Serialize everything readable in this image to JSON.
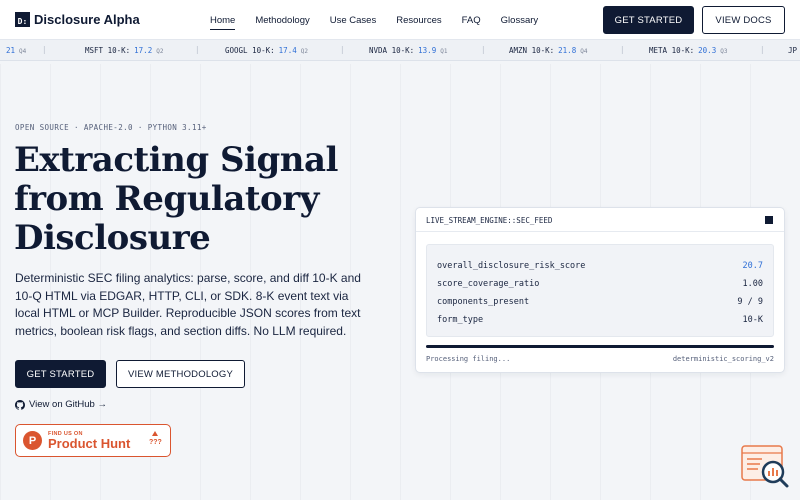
{
  "brand": {
    "mark": "D:",
    "name": "Disclosure Alpha"
  },
  "nav": {
    "items": [
      "Home",
      "Methodology",
      "Use Cases",
      "Resources",
      "FAQ",
      "Glossary"
    ],
    "active": "Home",
    "get_started": "GET STARTED",
    "view_docs": "VIEW DOCS"
  },
  "ticker": [
    {
      "label": "",
      "value": "21",
      "quarter": "Q4"
    },
    {
      "label": "MSFT 10-K:",
      "value": "17.2",
      "quarter": "Q2"
    },
    {
      "label": "GOOGL 10-K:",
      "value": "17.4",
      "quarter": "Q2"
    },
    {
      "label": "NVDA 10-K:",
      "value": "13.9",
      "quarter": "Q1"
    },
    {
      "label": "AMZN 10-K:",
      "value": "21.8",
      "quarter": "Q4"
    },
    {
      "label": "META 10-K:",
      "value": "20.3",
      "quarter": "Q3"
    },
    {
      "label": "JP",
      "value": "",
      "quarter": ""
    }
  ],
  "hero": {
    "tagline": "OPEN SOURCE · APACHE-2.0 · PYTHON 3.11+",
    "headline": [
      "Extracting Signal",
      "from Regulatory",
      "Disclosure"
    ],
    "description": "Deterministic SEC filing analytics: parse, score, and diff 10-K and 10-Q HTML via EDGAR, HTTP, CLI, or SDK. 8-K event text via local HTML or MCP Builder. Reproducible JSON scores from text metrics, boolean risk flags, and section diffs. No LLM required.",
    "get_started": "GET STARTED",
    "view_methodology": "VIEW METHODOLOGY",
    "github": "View on GitHub →",
    "producthunt": {
      "small": "FIND US ON",
      "big": "Product Hunt",
      "count": "???"
    }
  },
  "stream": {
    "title": "LIVE_STREAM_ENGINE::SEC_FEED",
    "metrics": [
      {
        "key": "overall_disclosure_risk_score",
        "value": "20.7",
        "accent": true
      },
      {
        "key": "score_coverage_ratio",
        "value": "1.00",
        "accent": false
      },
      {
        "key": "components_present",
        "value": "9 / 9",
        "accent": false
      },
      {
        "key": "form_type",
        "value": "10-K",
        "accent": false
      }
    ],
    "progress": 1.0,
    "status": "Processing filing...",
    "engine": "deterministic_scoring_v2"
  },
  "colors": {
    "navy": "#0f1a33",
    "accent_blue": "#2f6fd6",
    "producthunt_orange": "#da552f",
    "page_bg": "#f3f5f8"
  }
}
